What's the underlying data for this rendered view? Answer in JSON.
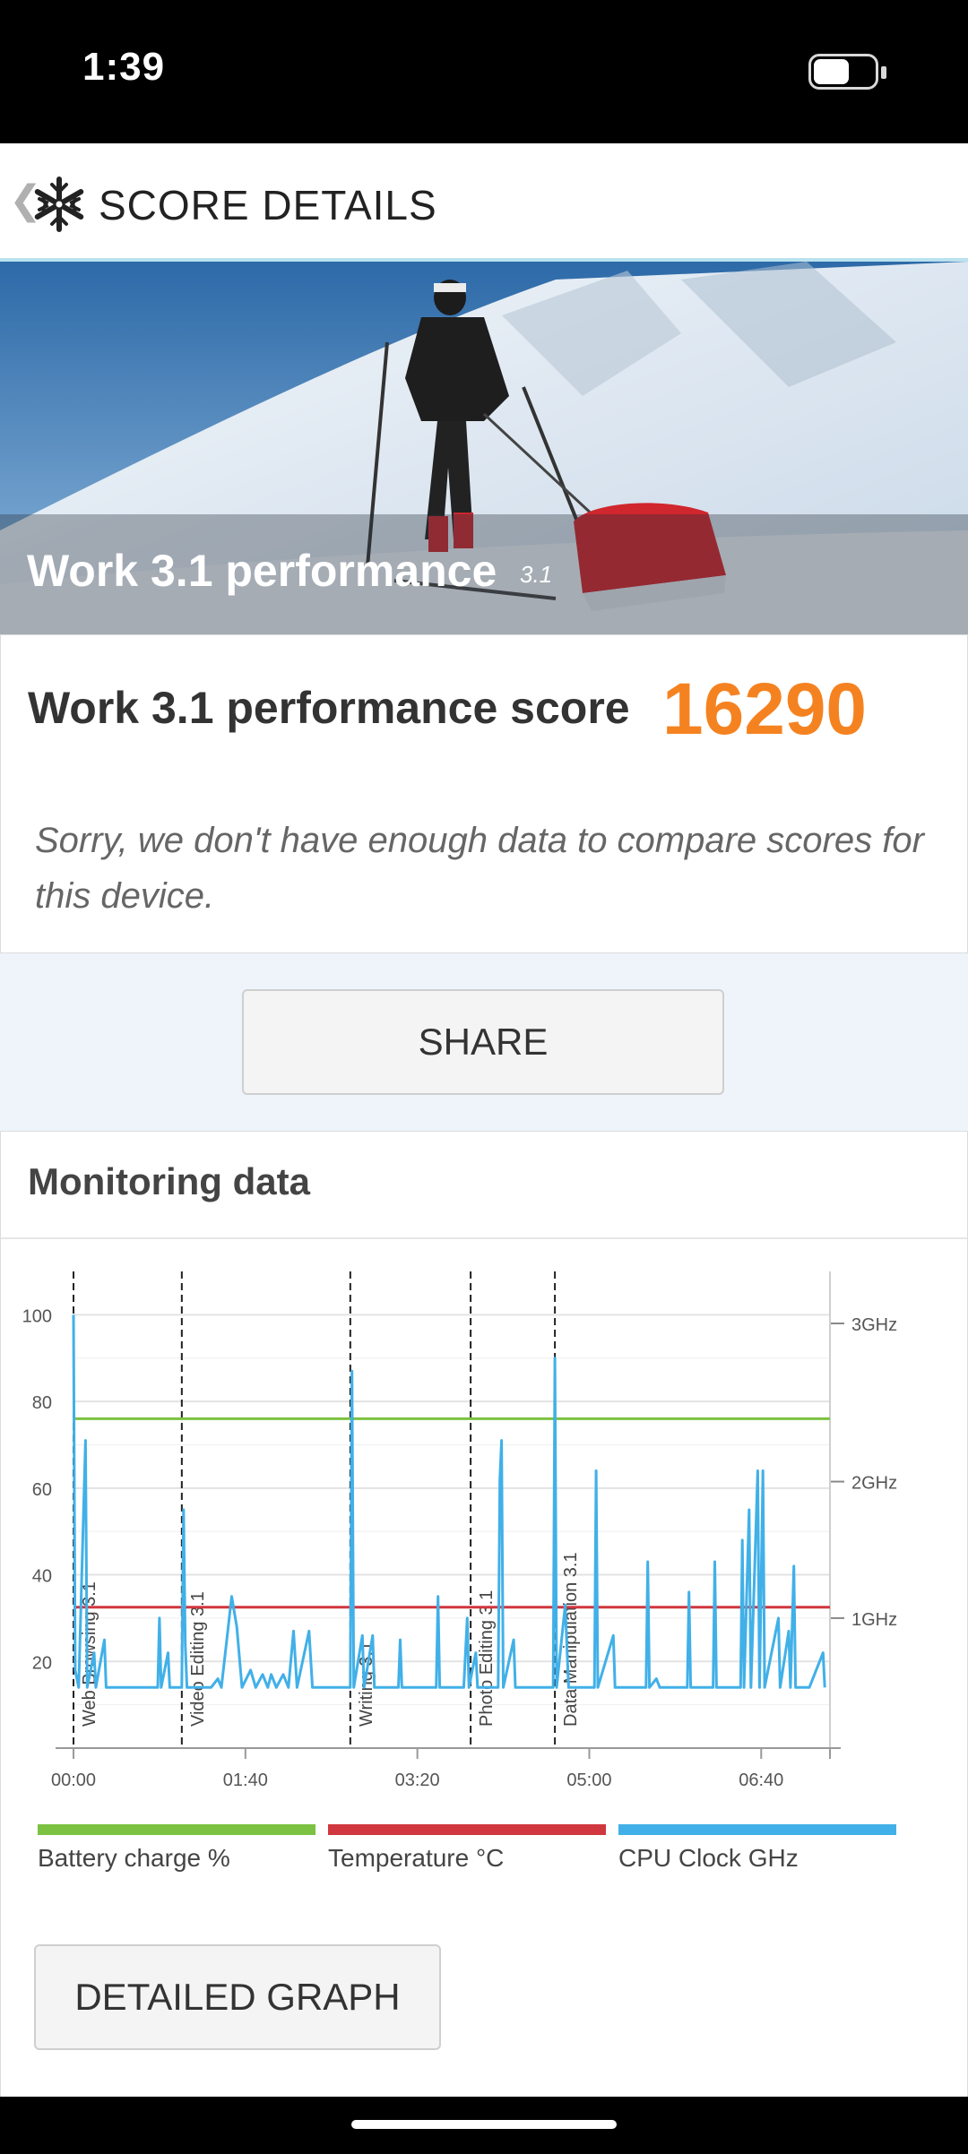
{
  "status_bar": {
    "time": "1:39",
    "battery_level": 0.62
  },
  "header": {
    "title": "SCORE DETAILS",
    "back_icon": "chevron-left-icon",
    "logo_icon": "snowflake-icon"
  },
  "hero": {
    "title": "Work 3.1 performance",
    "version": "3.1"
  },
  "score": {
    "label": "Work 3.1 performance score",
    "value": "16290"
  },
  "compare": {
    "message": "Sorry, we don't have enough data to compare scores for this device."
  },
  "share": {
    "label": "SHARE"
  },
  "monitoring": {
    "title": "Monitoring data",
    "detail_button": "DETAILED GRAPH",
    "legend": [
      {
        "label": "Battery charge %",
        "color": "#7cc242"
      },
      {
        "label": "Temperature °C",
        "color": "#d0373e"
      },
      {
        "label": "CPU Clock GHz",
        "color": "#41b0e8"
      }
    ]
  },
  "chart_data": {
    "type": "line",
    "x_label_ticks": [
      "00:00",
      "01:40",
      "03:20",
      "05:00",
      "06:40"
    ],
    "x_range_seconds": [
      0,
      440
    ],
    "y_left_ticks": [
      "100",
      "80",
      "60",
      "40",
      "20"
    ],
    "y_left_range": [
      0,
      110
    ],
    "y_right_ticks": [
      "3GHz",
      "2GHz",
      "1GHz"
    ],
    "phases": [
      {
        "name": "Web Browsing 3.1",
        "start_s": 0
      },
      {
        "name": "Video Editing 3.1",
        "start_s": 63
      },
      {
        "name": "Writing 3.1",
        "start_s": 161
      },
      {
        "name": "Photo Editing 3.1",
        "start_s": 231
      },
      {
        "name": "Data Manipulation 3.1",
        "start_s": 280
      }
    ],
    "series": [
      {
        "name": "Battery charge %",
        "color": "#7cc242",
        "values": [
          [
            0,
            76
          ],
          [
            440,
            76
          ]
        ]
      },
      {
        "name": "Temperature °C",
        "color": "#d0373e",
        "values": [
          [
            0,
            32.5
          ],
          [
            440,
            32.5
          ]
        ]
      },
      {
        "name": "CPU Clock GHz",
        "color": "#41b0e8",
        "values": [
          [
            0,
            100
          ],
          [
            1,
            18
          ],
          [
            3,
            14
          ],
          [
            7,
            71
          ],
          [
            8,
            14
          ],
          [
            12,
            22
          ],
          [
            13,
            14
          ],
          [
            18,
            25
          ],
          [
            19,
            14
          ],
          [
            49,
            14
          ],
          [
            50,
            30
          ],
          [
            51,
            14
          ],
          [
            55,
            22
          ],
          [
            56,
            14
          ],
          [
            63,
            14
          ],
          [
            64,
            55
          ],
          [
            65,
            24
          ],
          [
            66,
            14
          ],
          [
            80,
            14
          ],
          [
            84,
            16
          ],
          [
            86,
            14
          ],
          [
            92,
            35
          ],
          [
            95,
            28
          ],
          [
            98,
            14
          ],
          [
            103,
            18
          ],
          [
            106,
            14
          ],
          [
            110,
            17
          ],
          [
            113,
            14
          ],
          [
            115,
            17
          ],
          [
            118,
            14
          ],
          [
            122,
            17
          ],
          [
            125,
            14
          ],
          [
            128,
            27
          ],
          [
            130,
            14
          ],
          [
            137,
            27
          ],
          [
            139,
            14
          ],
          [
            161,
            14
          ],
          [
            162,
            87
          ],
          [
            163,
            14
          ],
          [
            168,
            26
          ],
          [
            169,
            14
          ],
          [
            174,
            26
          ],
          [
            175,
            14
          ],
          [
            189,
            14
          ],
          [
            190,
            25
          ],
          [
            191,
            14
          ],
          [
            211,
            14
          ],
          [
            212,
            35
          ],
          [
            213,
            14
          ],
          [
            227,
            14
          ],
          [
            229,
            30
          ],
          [
            230,
            14
          ],
          [
            234,
            22
          ],
          [
            235,
            14
          ],
          [
            247,
            14
          ],
          [
            248,
            62
          ],
          [
            249,
            71
          ],
          [
            250,
            14
          ],
          [
            256,
            25
          ],
          [
            257,
            14
          ],
          [
            279,
            14
          ],
          [
            280,
            90
          ],
          [
            281,
            14
          ],
          [
            286,
            33
          ],
          [
            288,
            14
          ],
          [
            303,
            14
          ],
          [
            304,
            64
          ],
          [
            305,
            14
          ],
          [
            314,
            26
          ],
          [
            315,
            14
          ],
          [
            333,
            14
          ],
          [
            334,
            43
          ],
          [
            335,
            14
          ],
          [
            339,
            16
          ],
          [
            341,
            14
          ],
          [
            357,
            14
          ],
          [
            358,
            36
          ],
          [
            359,
            14
          ],
          [
            372,
            14
          ],
          [
            373,
            43
          ],
          [
            374,
            14
          ],
          [
            388,
            14
          ],
          [
            389,
            48
          ],
          [
            390,
            14
          ],
          [
            393,
            55
          ],
          [
            394,
            14
          ],
          [
            398,
            64
          ],
          [
            399,
            14
          ],
          [
            401,
            64
          ],
          [
            402,
            14
          ],
          [
            410,
            30
          ],
          [
            411,
            14
          ],
          [
            416,
            27
          ],
          [
            417,
            14
          ],
          [
            419,
            42
          ],
          [
            420,
            14
          ],
          [
            428,
            14
          ],
          [
            436,
            22
          ],
          [
            437,
            14
          ]
        ]
      }
    ]
  }
}
